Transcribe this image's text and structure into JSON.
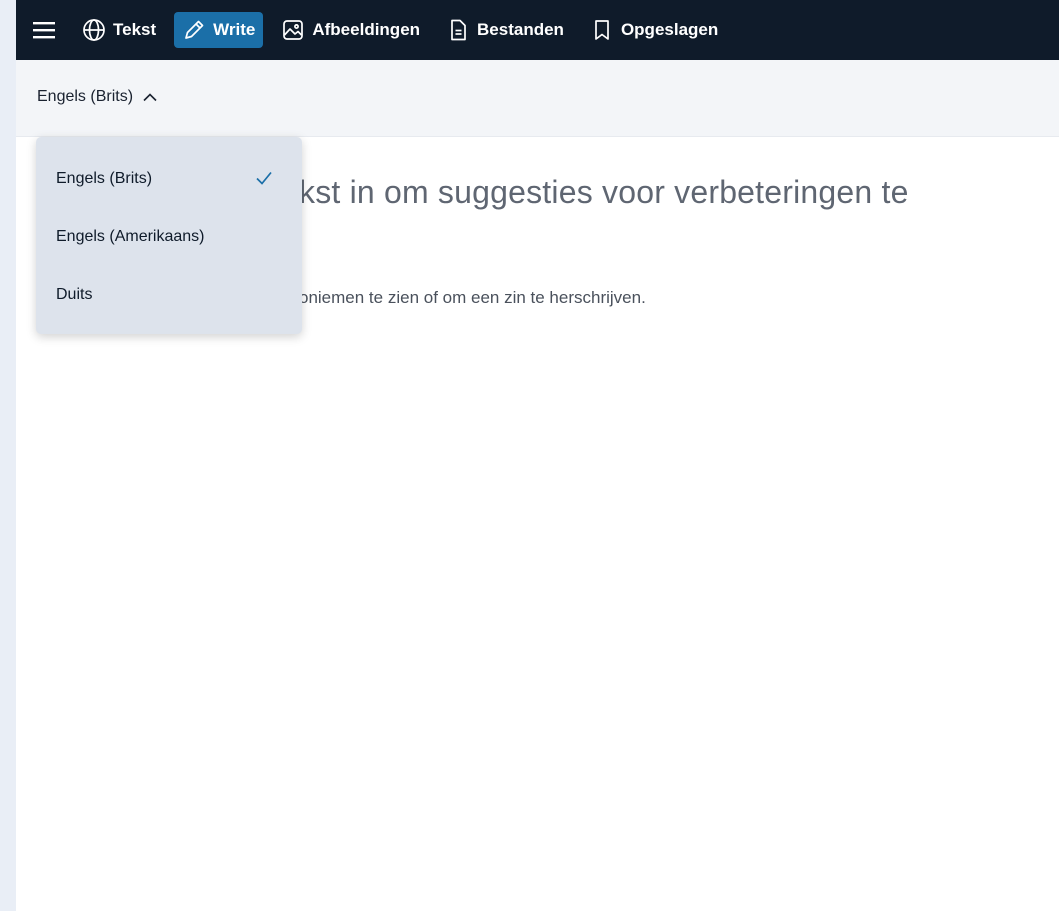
{
  "nav": {
    "tabs": [
      {
        "label": "Tekst",
        "icon": "globe-icon"
      },
      {
        "label": "Write",
        "icon": "pencil-icon",
        "active": true
      },
      {
        "label": "Afbeeldingen",
        "icon": "image-icon"
      },
      {
        "label": "Bestanden",
        "icon": "document-icon"
      },
      {
        "label": "Opgeslagen",
        "icon": "bookmark-icon"
      }
    ]
  },
  "toolbar": {
    "language_label": "Engels (Brits)"
  },
  "dropdown": {
    "options": [
      "Engels (Brits)",
      "Engels (Amerikaans)",
      "Duits"
    ],
    "selected": "Engels (Brits)"
  },
  "main": {
    "headline_visible": "kst in om suggesties voor verbeteringen te",
    "subline_visible": "oniemen te zien of om een zin te herschrijven."
  },
  "colors": {
    "topbar": "#0f1b2a",
    "active_tab": "#1b6fa8",
    "check": "#1b6fa8",
    "dropdown_bg": "#dde3ec"
  }
}
